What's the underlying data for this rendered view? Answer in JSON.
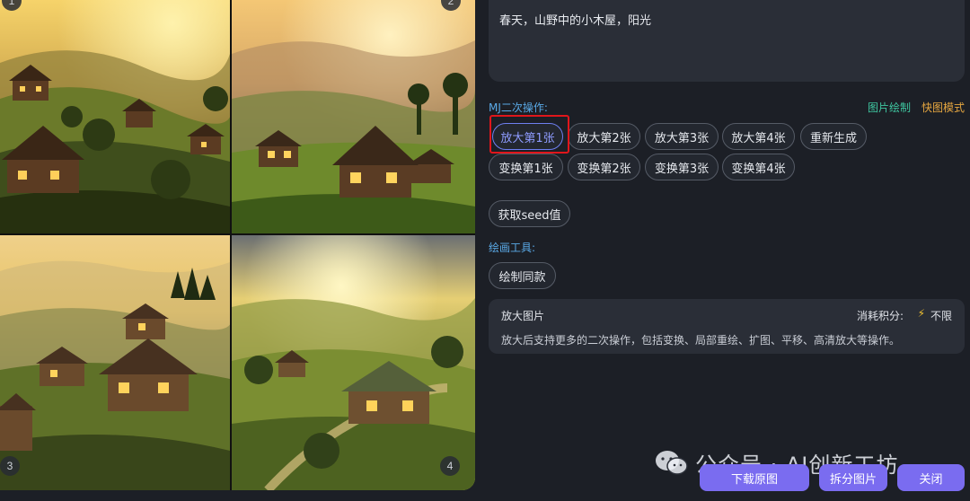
{
  "prompt": {
    "text": "春天，山野中的小木屋，阳光"
  },
  "mj_section": {
    "label": "MJ二次操作:",
    "link_draw": "图片绘制",
    "link_fast": "快图模式",
    "row1": [
      "放大第1张",
      "放大第2张",
      "放大第3张",
      "放大第4张",
      "重新生成"
    ],
    "row2": [
      "变换第1张",
      "变换第2张",
      "变换第3张",
      "变换第4张"
    ],
    "seed": "获取seed值"
  },
  "tools_section": {
    "label": "绘画工具:",
    "same_draw": "绘制同款"
  },
  "info_card": {
    "title": "放大图片",
    "cost_label": "消耗积分:",
    "cost_value": "不限",
    "desc": "放大后支持更多的二次操作，包括变换、局部重绘、扩图、平移、高清放大等操作。"
  },
  "images": {
    "badges": [
      "1",
      "2",
      "3",
      "4"
    ]
  },
  "footer": {
    "download": "下载原图",
    "split": "拆分图片",
    "close": "关闭"
  },
  "watermark": {
    "text": "公众号 · AI创新工坊"
  },
  "colors": {
    "accent": "#7a6cf0",
    "highlight": "#e0161b",
    "link_draw": "#3fc6a0",
    "link_fast": "#e5a640"
  }
}
